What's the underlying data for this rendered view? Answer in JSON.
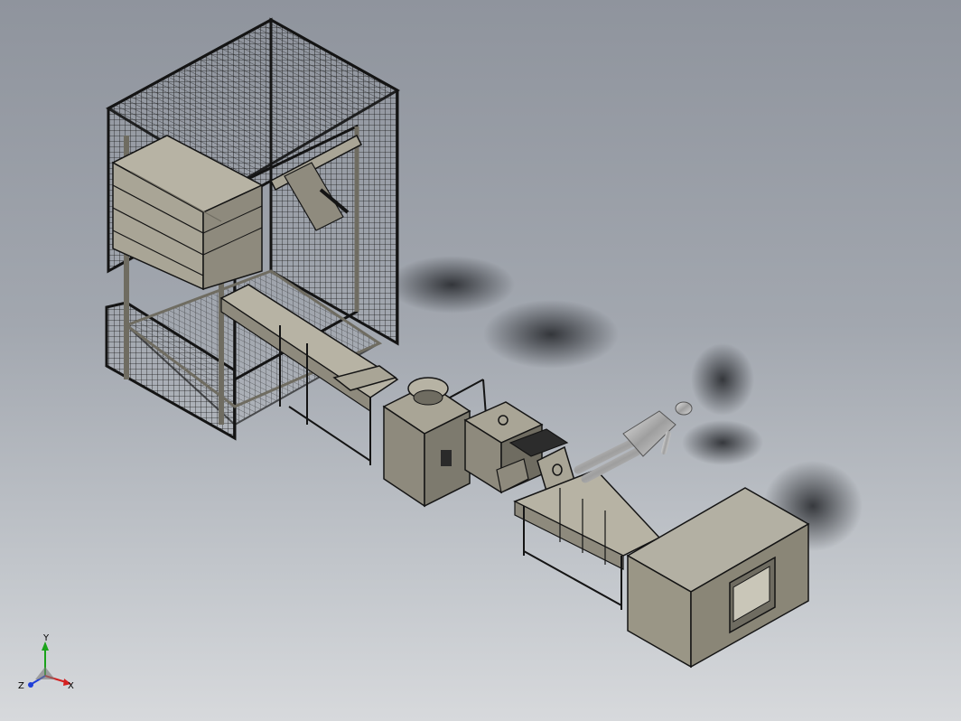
{
  "viewport": {
    "background_top": "#8f949d",
    "background_bottom": "#d7d9dc"
  },
  "scene": {
    "items": [
      {
        "id": "palletizer-cell",
        "kind": "wire-mesh-enclosure"
      },
      {
        "id": "pallet-stack",
        "kind": "pallet-stack"
      },
      {
        "id": "infeed-conveyor",
        "kind": "roller-conveyor"
      },
      {
        "id": "hopper-station",
        "kind": "hopper"
      },
      {
        "id": "feeder-unit",
        "kind": "feeder"
      },
      {
        "id": "sealing-unit",
        "kind": "sealer"
      },
      {
        "id": "outfeed-conveyor",
        "kind": "belt-conveyor"
      },
      {
        "id": "operator-figure",
        "kind": "human-mannequin"
      },
      {
        "id": "tunnel-box",
        "kind": "tunnel-housing"
      }
    ],
    "colors": {
      "metal": "#a9a596",
      "metal_dark": "#6f6c61",
      "edge": "#141414",
      "mesh": "#1a1a1a",
      "box": "#9a9686",
      "mannequin": "#c9c9c9"
    }
  },
  "triad": {
    "x_label": "X",
    "y_label": "Y",
    "z_label": "Z",
    "x_color": "#d42020",
    "y_color": "#1aa31a",
    "z_color": "#1f3fd8"
  }
}
